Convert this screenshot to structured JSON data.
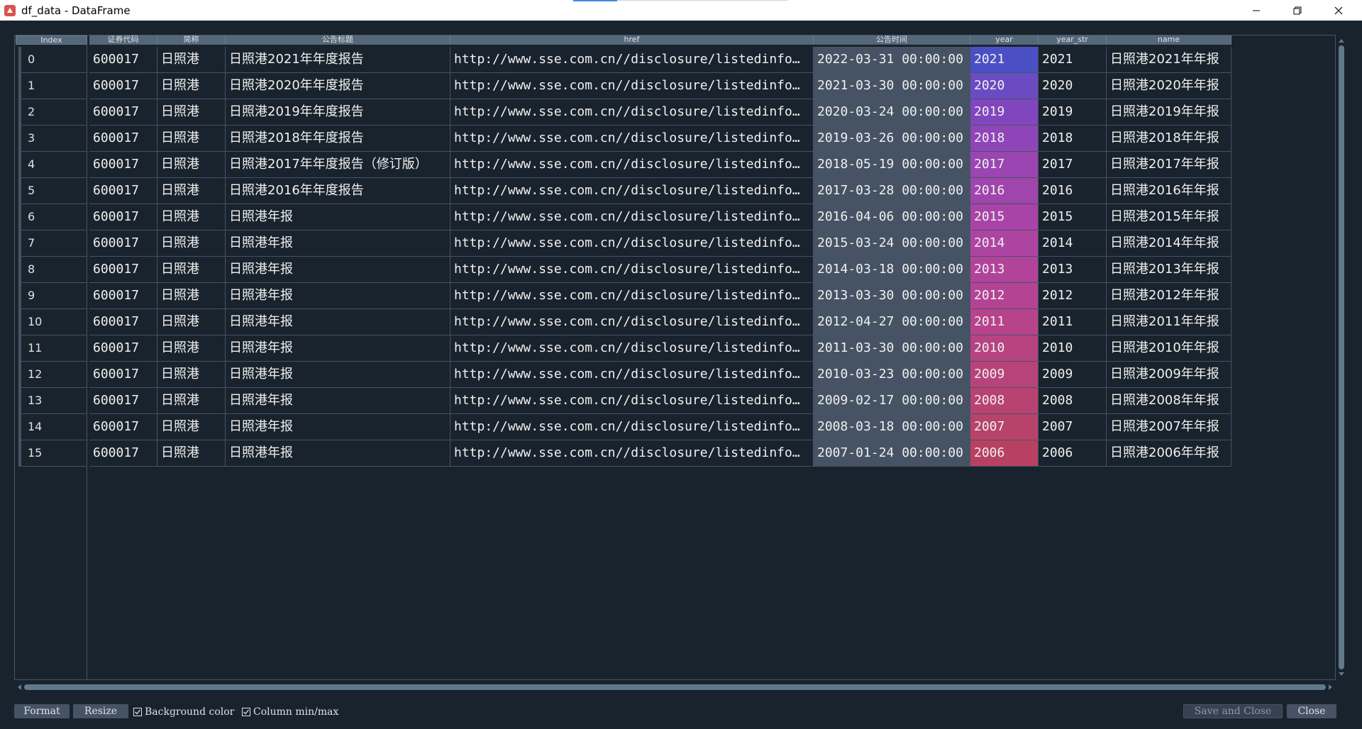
{
  "window": {
    "title": "df_data - DataFrame"
  },
  "colors": {
    "accent": "#3d8ee0",
    "background": "#19232d",
    "header": "#54687a",
    "date_bg": "#455364",
    "year_gradient": [
      "#4a4fc4",
      "#6a4bc2",
      "#8145be",
      "#8f45b8",
      "#9a45b2",
      "#a045ac",
      "#a844a8",
      "#ae44a2",
      "#b2439b",
      "#b44394",
      "#b6438b",
      "#b74383",
      "#b8437a",
      "#b84372",
      "#b8436a",
      "#b84062"
    ]
  },
  "table": {
    "headers": [
      "Index",
      "证券代码",
      "简称",
      "公告标题",
      "href",
      "公告时间",
      "year",
      "year_str",
      "name"
    ],
    "rows": [
      {
        "index": "0",
        "code": "600017",
        "short": "日照港",
        "title": "日照港2021年年度报告",
        "href": "http://www.sse.com.cn//disclosure/listedinfo…",
        "time": "2022-03-31 00:00:00",
        "year": "2021",
        "year_str": "2021",
        "name": "日照港2021年年报"
      },
      {
        "index": "1",
        "code": "600017",
        "short": "日照港",
        "title": "日照港2020年年度报告",
        "href": "http://www.sse.com.cn//disclosure/listedinfo…",
        "time": "2021-03-30 00:00:00",
        "year": "2020",
        "year_str": "2020",
        "name": "日照港2020年年报"
      },
      {
        "index": "2",
        "code": "600017",
        "short": "日照港",
        "title": "日照港2019年年度报告",
        "href": "http://www.sse.com.cn//disclosure/listedinfo…",
        "time": "2020-03-24 00:00:00",
        "year": "2019",
        "year_str": "2019",
        "name": "日照港2019年年报"
      },
      {
        "index": "3",
        "code": "600017",
        "short": "日照港",
        "title": "日照港2018年年度报告",
        "href": "http://www.sse.com.cn//disclosure/listedinfo…",
        "time": "2019-03-26 00:00:00",
        "year": "2018",
        "year_str": "2018",
        "name": "日照港2018年年报"
      },
      {
        "index": "4",
        "code": "600017",
        "short": "日照港",
        "title": "日照港2017年年度报告（修订版）",
        "href": "http://www.sse.com.cn//disclosure/listedinfo…",
        "time": "2018-05-19 00:00:00",
        "year": "2017",
        "year_str": "2017",
        "name": "日照港2017年年报"
      },
      {
        "index": "5",
        "code": "600017",
        "short": "日照港",
        "title": "日照港2016年年度报告",
        "href": "http://www.sse.com.cn//disclosure/listedinfo…",
        "time": "2017-03-28 00:00:00",
        "year": "2016",
        "year_str": "2016",
        "name": "日照港2016年年报"
      },
      {
        "index": "6",
        "code": "600017",
        "short": "日照港",
        "title": "日照港年报",
        "href": "http://www.sse.com.cn//disclosure/listedinfo…",
        "time": "2016-04-06 00:00:00",
        "year": "2015",
        "year_str": "2015",
        "name": "日照港2015年年报"
      },
      {
        "index": "7",
        "code": "600017",
        "short": "日照港",
        "title": "日照港年报",
        "href": "http://www.sse.com.cn//disclosure/listedinfo…",
        "time": "2015-03-24 00:00:00",
        "year": "2014",
        "year_str": "2014",
        "name": "日照港2014年年报"
      },
      {
        "index": "8",
        "code": "600017",
        "short": "日照港",
        "title": "日照港年报",
        "href": "http://www.sse.com.cn//disclosure/listedinfo…",
        "time": "2014-03-18 00:00:00",
        "year": "2013",
        "year_str": "2013",
        "name": "日照港2013年年报"
      },
      {
        "index": "9",
        "code": "600017",
        "short": "日照港",
        "title": "日照港年报",
        "href": "http://www.sse.com.cn//disclosure/listedinfo…",
        "time": "2013-03-30 00:00:00",
        "year": "2012",
        "year_str": "2012",
        "name": "日照港2012年年报"
      },
      {
        "index": "10",
        "code": "600017",
        "short": "日照港",
        "title": "日照港年报",
        "href": "http://www.sse.com.cn//disclosure/listedinfo…",
        "time": "2012-04-27 00:00:00",
        "year": "2011",
        "year_str": "2011",
        "name": "日照港2011年年报"
      },
      {
        "index": "11",
        "code": "600017",
        "short": "日照港",
        "title": "日照港年报",
        "href": "http://www.sse.com.cn//disclosure/listedinfo…",
        "time": "2011-03-30 00:00:00",
        "year": "2010",
        "year_str": "2010",
        "name": "日照港2010年年报"
      },
      {
        "index": "12",
        "code": "600017",
        "short": "日照港",
        "title": "日照港年报",
        "href": "http://www.sse.com.cn//disclosure/listedinfo…",
        "time": "2010-03-23 00:00:00",
        "year": "2009",
        "year_str": "2009",
        "name": "日照港2009年年报"
      },
      {
        "index": "13",
        "code": "600017",
        "short": "日照港",
        "title": "日照港年报",
        "href": "http://www.sse.com.cn//disclosure/listedinfo…",
        "time": "2009-02-17 00:00:00",
        "year": "2008",
        "year_str": "2008",
        "name": "日照港2008年年报"
      },
      {
        "index": "14",
        "code": "600017",
        "short": "日照港",
        "title": "日照港年报",
        "href": "http://www.sse.com.cn//disclosure/listedinfo…",
        "time": "2008-03-18 00:00:00",
        "year": "2007",
        "year_str": "2007",
        "name": "日照港2007年年报"
      },
      {
        "index": "15",
        "code": "600017",
        "short": "日照港",
        "title": "日照港年报",
        "href": "http://www.sse.com.cn//disclosure/listedinfo…",
        "time": "2007-01-24 00:00:00",
        "year": "2006",
        "year_str": "2006",
        "name": "日照港2006年年报"
      }
    ]
  },
  "toolbar": {
    "format_label": "Format",
    "resize_label": "Resize",
    "bg_color_label": "Background color",
    "bg_color_checked": true,
    "col_minmax_label": "Column min/max",
    "col_minmax_checked": true,
    "save_close_label": "Save and Close",
    "close_label": "Close"
  }
}
